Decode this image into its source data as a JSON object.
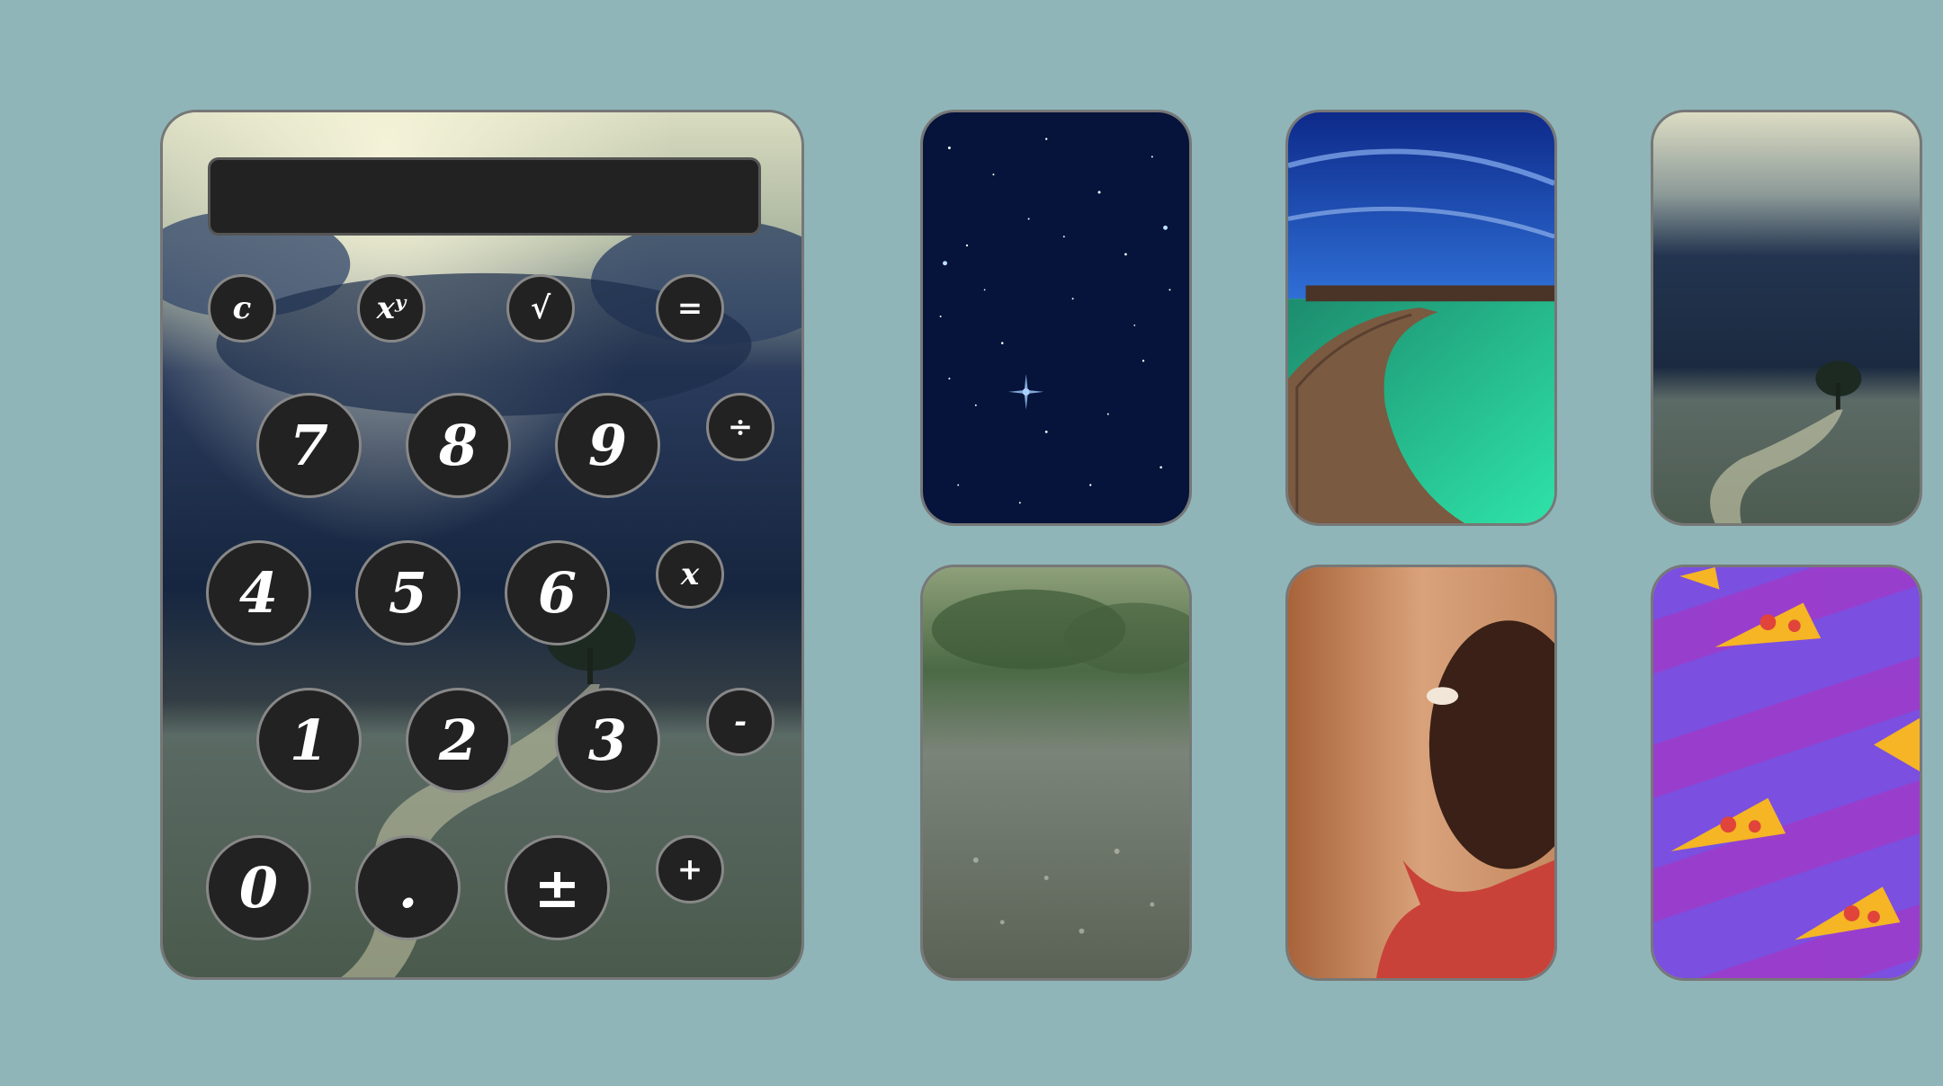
{
  "calculator": {
    "display_value": "",
    "keys": {
      "clear": "c",
      "power": "xʸ",
      "sqrt": "√",
      "equals": "=",
      "seven": "7",
      "eight": "8",
      "nine": "9",
      "divide": "÷",
      "four": "4",
      "five": "5",
      "six": "6",
      "multiply": "x",
      "one": "1",
      "two": "2",
      "three": "3",
      "minus": "-",
      "zero": "0",
      "decimal": ".",
      "plus_minus": "±",
      "plus": "+"
    }
  },
  "themes": [
    {
      "icon": "starry-sky-theme"
    },
    {
      "icon": "ocean-boardwalk-theme"
    },
    {
      "icon": "storm-clouds-theme"
    },
    {
      "icon": "rain-theme"
    },
    {
      "icon": "person-gif-theme"
    },
    {
      "icon": "pizza-pattern-theme"
    }
  ],
  "colors": {
    "page_background": "#8fb5b8",
    "key_background": "#222222",
    "key_border": "#888888"
  }
}
